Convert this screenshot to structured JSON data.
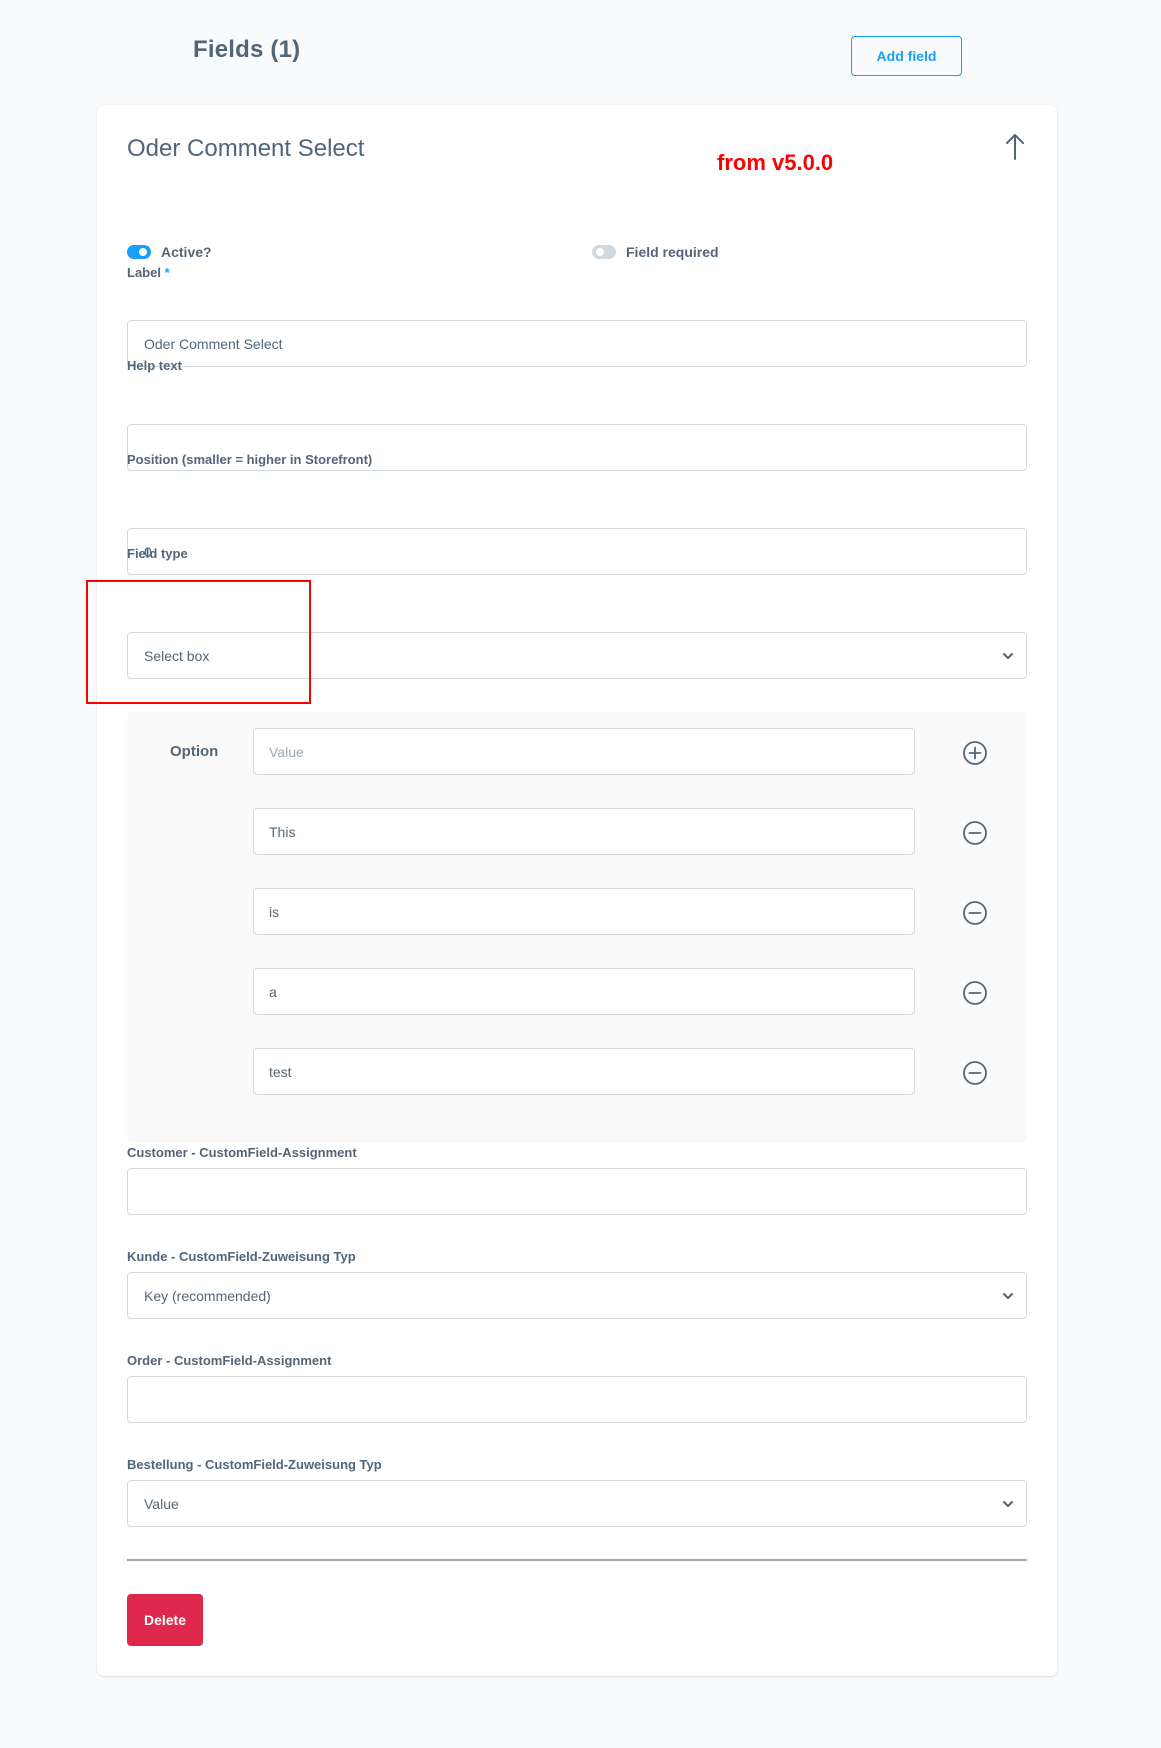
{
  "header": {
    "title": "Fields (1)",
    "add_field_label": "Add field"
  },
  "field": {
    "title": "Oder Comment Select",
    "annotation": "from v5.0.0",
    "active": {
      "label": "Active?",
      "checked": true
    },
    "required": {
      "label": "Field required",
      "checked": false
    },
    "label_field": {
      "label": "Label",
      "required_mark": "*",
      "value": "Oder Comment Select"
    },
    "help_text": {
      "label": "Help text",
      "value": ""
    },
    "position": {
      "label": "Position (smaller = higher in Storefront)",
      "value": "0"
    },
    "field_type": {
      "label": "Field type",
      "value": "Select box"
    },
    "options": {
      "label": "Option",
      "new_placeholder": "Value",
      "values": [
        "This",
        "is",
        "a",
        "test"
      ]
    },
    "customer_assignment": {
      "label": "Customer - CustomField-Assignment",
      "value": ""
    },
    "customer_assignment_type": {
      "label": "Kunde - CustomField-Zuweisung Typ",
      "value": "Key (recommended)"
    },
    "order_assignment": {
      "label": "Order - CustomField-Assignment",
      "value": ""
    },
    "order_assignment_type": {
      "label": "Bestellung - CustomField-Zuweisung Typ",
      "value": "Value"
    },
    "delete_label": "Delete"
  },
  "icons": {
    "collapse": "arrow-up-icon",
    "add_option": "plus-circle-icon",
    "remove_option": "minus-circle-icon",
    "select": "chevron-down-icon"
  },
  "colors": {
    "accent": "#189eff",
    "danger": "#de294c",
    "annotation": "#ff0000",
    "text": "#52667a",
    "border": "#d1d9e0"
  }
}
